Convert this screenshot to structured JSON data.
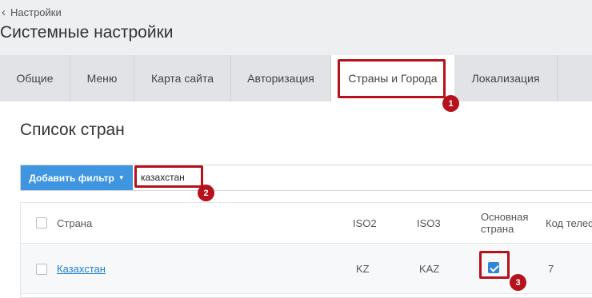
{
  "breadcrumb": {
    "back_label": "Настройки"
  },
  "page": {
    "title": "Системные настройки"
  },
  "tabs": [
    {
      "label": "Общие"
    },
    {
      "label": "Меню"
    },
    {
      "label": "Карта сайта"
    },
    {
      "label": "Авторизация"
    },
    {
      "label": "Страны и Города",
      "active": true
    },
    {
      "label": "Локализация"
    }
  ],
  "section": {
    "title": "Список стран"
  },
  "filter": {
    "add_filter_label": "Добавить фильтр",
    "search_value": "казахстан"
  },
  "table": {
    "columns": [
      "Страна",
      "ISO2",
      "ISO3",
      "Основная страна",
      "Код телеф"
    ],
    "main_country_header": {
      "line1": "Основная",
      "line2": "страна"
    },
    "rows": [
      {
        "country": "Казахстан",
        "iso2": "KZ",
        "iso3": "KAZ",
        "main_country": true,
        "phone_code": "7"
      }
    ]
  },
  "annotations": [
    {
      "number": "1"
    },
    {
      "number": "2"
    },
    {
      "number": "3"
    }
  ],
  "colors": {
    "accent": "#3f95e0",
    "annotation": "#b5121b",
    "link": "#1f7fd0"
  }
}
